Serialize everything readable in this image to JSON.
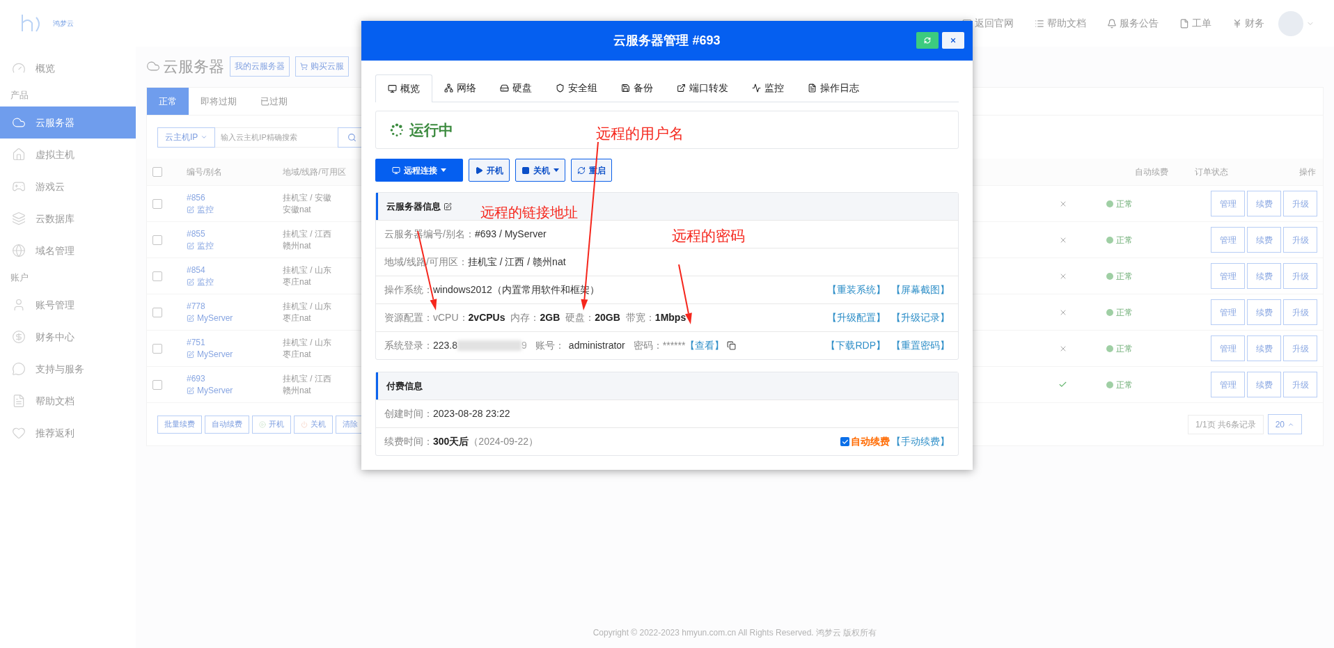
{
  "header": {
    "logo_text": "鸿梦云",
    "nav": [
      {
        "label": "返回官网"
      },
      {
        "label": "帮助文档"
      },
      {
        "label": "服务公告"
      },
      {
        "label": "工单"
      },
      {
        "label": "财务"
      }
    ]
  },
  "sidebar": {
    "items": [
      {
        "kind": "item",
        "label": "概览",
        "selected": false
      },
      {
        "kind": "section",
        "label": "产品"
      },
      {
        "kind": "item",
        "label": "云服务器",
        "selected": true
      },
      {
        "kind": "item",
        "label": "虚拟主机",
        "selected": false
      },
      {
        "kind": "item",
        "label": "游戏云",
        "selected": false
      },
      {
        "kind": "item",
        "label": "云数据库",
        "selected": false
      },
      {
        "kind": "item",
        "label": "域名管理",
        "selected": false
      },
      {
        "kind": "section",
        "label": "账户"
      },
      {
        "kind": "item",
        "label": "账号管理",
        "selected": false
      },
      {
        "kind": "item",
        "label": "财务中心",
        "selected": false
      },
      {
        "kind": "item",
        "label": "支持与服务",
        "selected": false
      },
      {
        "kind": "item",
        "label": "帮助文档",
        "selected": false
      },
      {
        "kind": "item",
        "label": "推荐返利",
        "selected": false
      }
    ]
  },
  "page": {
    "title": "云服务器",
    "buttons": [
      "我的云服务器",
      "购买云服"
    ],
    "tabs": [
      {
        "label": "正常",
        "selected": true
      },
      {
        "label": "即将过期",
        "selected": false
      },
      {
        "label": "已过期",
        "selected": false
      }
    ],
    "search": {
      "filter": "云主机IP",
      "placeholder": "输入云主机IP精确搜索"
    }
  },
  "table": {
    "select_all_checked": false,
    "columns": [
      "编号/别名",
      "地域/线路/可用区",
      "自动续费",
      "订单状态",
      "操作"
    ],
    "rows": [
      {
        "checked": false,
        "id": "#856",
        "alias": "监控",
        "region": "挂机宝 / 安徽",
        "zone": "安徽nat",
        "auto_renew": false,
        "status": "正常",
        "actions": [
          "管理",
          "续费",
          "升级"
        ]
      },
      {
        "checked": false,
        "id": "#855",
        "alias": "监控",
        "region": "挂机宝 / 江西",
        "zone": "赣州nat",
        "auto_renew": false,
        "status": "正常",
        "actions": [
          "管理",
          "续费",
          "升级"
        ]
      },
      {
        "checked": false,
        "id": "#854",
        "alias": "监控",
        "region": "挂机宝 / 山东",
        "zone": "枣庄nat",
        "auto_renew": false,
        "status": "正常",
        "actions": [
          "管理",
          "续费",
          "升级"
        ]
      },
      {
        "checked": false,
        "id": "#778",
        "alias": "MyServer",
        "region": "挂机宝 / 山东",
        "zone": "枣庄nat",
        "auto_renew": false,
        "status": "正常",
        "actions": [
          "管理",
          "续费",
          "升级"
        ]
      },
      {
        "checked": false,
        "id": "#751",
        "alias": "MyServer",
        "region": "挂机宝 / 山东",
        "zone": "枣庄nat",
        "auto_renew": false,
        "status": "正常",
        "actions": [
          "管理",
          "续费",
          "升级"
        ]
      },
      {
        "checked": false,
        "id": "#693",
        "alias": "MyServer",
        "region": "挂机宝 / 江西",
        "zone": "赣州nat",
        "auto_renew": true,
        "status": "正常",
        "actions": [
          "管理",
          "续费",
          "升级"
        ]
      }
    ],
    "bulk_actions": [
      {
        "kind": "plain",
        "label": "批量续费"
      },
      {
        "kind": "plain",
        "label": "自动续费"
      },
      {
        "kind": "start",
        "label": "开机"
      },
      {
        "kind": "stop",
        "label": "关机"
      },
      {
        "kind": "plain",
        "label": "清除"
      }
    ],
    "pagination": "1/1页 共6条记录",
    "page_size": "20"
  },
  "footer": "Copyright © 2022-2023 hmyun.com.cn All Rights Reserved. 鸿梦云 版权所有",
  "modal": {
    "title": "云服务器管理 #693",
    "tabs": [
      {
        "label": "概览",
        "selected": true
      },
      {
        "label": "网络",
        "selected": false
      },
      {
        "label": "硬盘",
        "selected": false
      },
      {
        "label": "安全组",
        "selected": false
      },
      {
        "label": "备份",
        "selected": false
      },
      {
        "label": "端口转发",
        "selected": false
      },
      {
        "label": "监控",
        "selected": false
      },
      {
        "label": "操作日志",
        "selected": false
      }
    ],
    "status": "运行中",
    "actions": [
      {
        "kind": "primary",
        "label": "远程连接",
        "dropdown": true
      },
      {
        "kind": "outline",
        "label": "开机",
        "dropdown": false
      },
      {
        "kind": "outline",
        "label": "关机",
        "dropdown": true
      },
      {
        "kind": "outline",
        "label": "重启",
        "dropdown": false
      }
    ],
    "info_panel": {
      "title": "云服务器信息",
      "rows": [
        {
          "kind": "text",
          "label": "云服务器编号/别名：",
          "value": "#693 / MyServer"
        },
        {
          "kind": "text",
          "label": "地域/线路/可用区：",
          "value": "挂机宝 / 江西 / 赣州nat"
        },
        {
          "kind": "text",
          "label": "操作系统：",
          "value": "windows2012（内置常用软件和框架）",
          "links": [
            "【重装系统】",
            "【屏幕截图】"
          ]
        },
        {
          "kind": "specs",
          "label": "资源配置：",
          "specs": [
            {
              "label": "vCPU：",
              "value": "2vCPUs"
            },
            {
              "label": "内存：",
              "value": "2GB"
            },
            {
              "label": "硬盘：",
              "value": "20GB"
            },
            {
              "label": "带宽：",
              "value": "1Mbps"
            }
          ],
          "links": [
            "【升级配置】",
            "【升级记录】"
          ]
        },
        {
          "kind": "login",
          "label": "系统登录：",
          "ip_start": "223.8",
          "ip_end": "9",
          "account_label": "账号：",
          "account": "administrator",
          "password_label": "密码：",
          "password": "******",
          "view_link": "【查看】",
          "links": [
            "【下载RDP】",
            "【重置密码】"
          ]
        }
      ]
    },
    "payment_panel": {
      "title": "付费信息",
      "rows": [
        {
          "kind": "text",
          "label": "创建时间：",
          "value": "2023-08-28 23:22"
        },
        {
          "kind": "renew",
          "label": "续费时间：",
          "value": "300天后",
          "date": "（2024-09-22）",
          "auto_renew": {
            "checked": true,
            "label": "自动续费"
          },
          "links": [
            "【手动续费】"
          ]
        }
      ]
    }
  },
  "annotations": [
    {
      "text": "远程的用户名"
    },
    {
      "text": "远程的链接地址"
    },
    {
      "text": "远程的密码"
    }
  ]
}
